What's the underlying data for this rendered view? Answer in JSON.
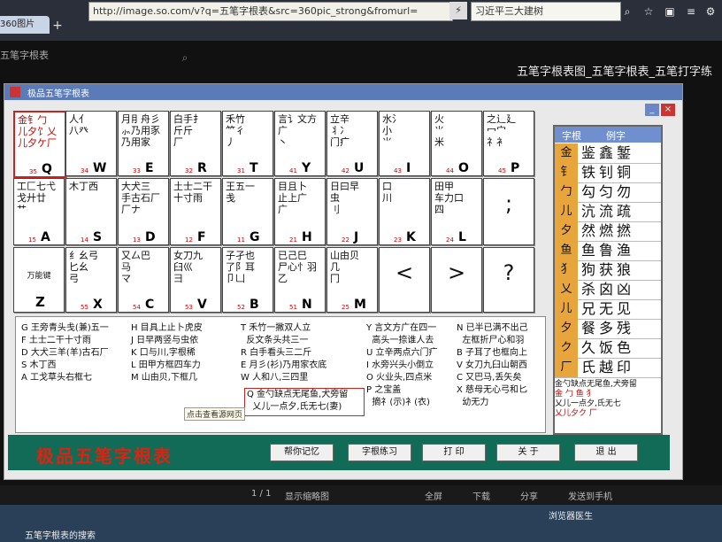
{
  "browser": {
    "tab_title": "360图片",
    "address": "http://image.so.com/v?q=五笔字根表&src=360pic_strong&fromurl=",
    "search_text": "习近平三大建树",
    "page_tab_label": "五笔字根表",
    "page_heading": "五笔字根表图_五笔字根表_五笔打字练"
  },
  "window": {
    "title": "极品五笔字根表",
    "min_label": "_",
    "close_label": "×"
  },
  "keys": [
    {
      "roots": "金钅勹\n儿夕饣乂\n儿夕ケ厂",
      "code": "35",
      "letter": "Q",
      "red": true
    },
    {
      "roots": "人亻\n八癶",
      "code": "34",
      "letter": "W"
    },
    {
      "roots": "月⺝舟彡\n⺗乃用豕\n乃用家",
      "code": "33",
      "letter": "E"
    },
    {
      "roots": "白手扌\n斤斤\n厂",
      "code": "32",
      "letter": "R"
    },
    {
      "roots": "禾竹\n⺮彳\n丿",
      "code": "31",
      "letter": "T"
    },
    {
      "roots": "言讠文方\n广\n丶",
      "code": "41",
      "letter": "Y"
    },
    {
      "roots": "立辛\n丬冫\n门疒",
      "code": "42",
      "letter": "U"
    },
    {
      "roots": "水氵\n小\n⺌",
      "code": "43",
      "letter": "I"
    },
    {
      "roots": "火\n⺌\n米",
      "code": "44",
      "letter": "O"
    },
    {
      "roots": "之辶廴\n冖宀\n礻衤",
      "code": "45",
      "letter": "P"
    },
    {
      "roots": "工匚七弋\n戈廾廿\n艹",
      "code": "15",
      "letter": "A"
    },
    {
      "roots": "木丁西",
      "code": "14",
      "letter": "S"
    },
    {
      "roots": "大犬三\n手古石厂\n厂ナ",
      "code": "13",
      "letter": "D"
    },
    {
      "roots": "土士二干\n十寸雨",
      "code": "12",
      "letter": "F"
    },
    {
      "roots": "王五一\n戋",
      "code": "11",
      "letter": "G"
    },
    {
      "roots": "目且卜\n止上广\n广",
      "code": "21",
      "letter": "H"
    },
    {
      "roots": "日曰早\n虫\n刂",
      "code": "22",
      "letter": "J"
    },
    {
      "roots": "口\n川",
      "code": "23",
      "letter": "K"
    },
    {
      "roots": "田甲\n车力口\n四",
      "code": "24",
      "letter": "L"
    },
    {
      "sym": ";",
      "special": true
    },
    {
      "label": "万能键",
      "letter": "Z",
      "wan": true
    },
    {
      "roots": "纟幺弓\n匕幺\n弓",
      "code": "55",
      "letter": "X"
    },
    {
      "roots": "又厶巴\n马\nマ",
      "code": "54",
      "letter": "C"
    },
    {
      "roots": "女刀九\n臼巛\n彐",
      "code": "53",
      "letter": "V"
    },
    {
      "roots": "子孑也\n了阝耳\n卩凵",
      "code": "52",
      "letter": "B"
    },
    {
      "roots": "已己巳\n尸心忄羽\n乙",
      "code": "51",
      "letter": "N"
    },
    {
      "roots": "山由贝\n几\n冂",
      "code": "25",
      "letter": "M"
    },
    {
      "sym": "<",
      "special": true
    },
    {
      "sym": ">",
      "special": true
    },
    {
      "sym": "?",
      "special": true
    }
  ],
  "sidebar": {
    "header_root": "字根",
    "header_example": "例字",
    "rows": [
      {
        "root": "金",
        "examples": "鉴鑫錾"
      },
      {
        "root": "钅",
        "examples": "铁钊铜"
      },
      {
        "root": "勹",
        "examples": "勾匀勿"
      },
      {
        "root": "儿",
        "examples": "沆流疏"
      },
      {
        "root": "夕",
        "examples": "然燃撚"
      },
      {
        "root": "鱼",
        "examples": "鱼鲁渔"
      },
      {
        "root": "犭",
        "examples": "狗获狼"
      },
      {
        "root": "乂",
        "examples": "杀囟凶"
      },
      {
        "root": "儿",
        "examples": "兄无见"
      },
      {
        "root": "夕",
        "examples": "餐多残"
      },
      {
        "root": "ク",
        "examples": "久饭色"
      },
      {
        "root": "厂",
        "examples": "氏越印"
      }
    ],
    "note_line1": "金勺缺点无尾鱼,犬旁留",
    "note_line2": "金 勹 鱼 犭",
    "note_line3": "乂儿一点夕,氏无七",
    "note_line4": "乂儿夕ク 厂"
  },
  "mnemonics": {
    "col1": [
      "G 王旁青头戋(兼)五一",
      "F 土士二干十寸雨",
      "D 大犬三羊(羊)古石厂",
      "S 木丁西",
      "A 工戈草头右框七"
    ],
    "col2": [
      "H 目具上止卜虎皮",
      "J 日早两竖与虫依",
      "K 口与川,字根稀",
      "L 田甲方框四车力",
      "M 山由贝,下框几"
    ],
    "col3": [
      "T 禾竹一撇双人立",
      "  反文条头共三一",
      "R 白手看头三二斤",
      "E 月彡(衫)乃用家衣底",
      "W 人和八,三四里"
    ],
    "q_box": [
      "Q 金勺缺点无尾鱼,犬旁留",
      "  乂儿一点夕,氏无七(妻)"
    ],
    "col4": [
      "Y 言文方广在四一",
      "  高头一捺谁人去",
      "U 立辛两点六门疒",
      "I 水旁兴头小倒立",
      "O 火业头,四点米",
      "P 之宝盖",
      "  摘礻(示)衤(衣)"
    ],
    "col5": [
      "N 已半已满不出己",
      "  左框折尸心和羽",
      "B 子耳了也框向上",
      "V 女刀九臼山朝西",
      "C 又巴马,丢矢矣",
      "X 慈母无心弓和匕",
      "  幼无力"
    ],
    "tooltip": "点击查看源网页"
  },
  "footer": {
    "brand": "极品五笔字根表",
    "buttons": [
      "帮你记忆",
      "字根练习",
      "打 印",
      "关 于",
      "退 出"
    ]
  },
  "statusbar": {
    "page": "1 / 1",
    "thumb": "显示缩略图",
    "fullscreen": "全屏",
    "download": "下载",
    "share": "分享",
    "send": "发送到手机"
  },
  "taskbar": {
    "task_label": "五笔字根表的搜索",
    "status_item": "浏览器医生"
  }
}
